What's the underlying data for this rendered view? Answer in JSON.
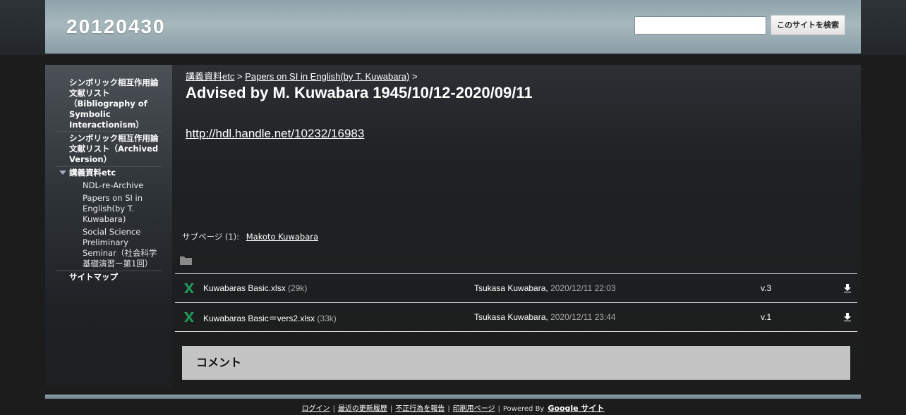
{
  "site": {
    "title": "20120430"
  },
  "search": {
    "placeholder": "",
    "button_label": "このサイトを検索"
  },
  "sidebar": {
    "items": [
      {
        "label": "シンボリック相互作用論文献リスト（Bibliography of Symbolic Interactionism）"
      },
      {
        "label": "シンボリック相互作用論文献リスト（Archived Version）"
      },
      {
        "label": "講義資料etc",
        "expanded": true,
        "children": [
          {
            "label": "NDL-re-Archive"
          },
          {
            "label": "Papers on SI in English(by T. Kuwabara)"
          },
          {
            "label": "Social Science Preliminary Seminar（社会科学基礎演習ー第1回）"
          }
        ]
      },
      {
        "label": "サイトマップ"
      }
    ]
  },
  "breadcrumb": {
    "items": [
      "講義資料etc",
      "Papers on SI in English(by T. Kuwabara)"
    ],
    "separator": ">"
  },
  "page": {
    "title": "Advised by M. Kuwabara 1945/10/12-2020/09/11",
    "link": "http://hdl.handle.net/10232/16983"
  },
  "subpages": {
    "label": "サブページ (1):",
    "items": [
      "Makoto Kuwabara"
    ]
  },
  "attachments": [
    {
      "name": "Kuwabaras Basic.xlsx",
      "size": "(29k)",
      "author": "Tsukasa Kuwabara,",
      "date": "2020/12/11 22:03",
      "version": "v.3"
    },
    {
      "name": "Kuwabaras Basic＝vers2.xlsx",
      "size": "(33k)",
      "author": "Tsukasa Kuwabara,",
      "date": "2020/12/11 23:44",
      "version": "v.1"
    }
  ],
  "comments": {
    "title": "コメント"
  },
  "footer": {
    "links": [
      "ログイン",
      "最近の更新履歴",
      "不正行為を報告",
      "印刷用ページ"
    ],
    "powered_by": "Powered By",
    "brand": "Google サイト"
  },
  "colors": {
    "header": "#a7b8bd",
    "xls_icon": "#1f9a5a",
    "comment_bg": "#c4c4c4"
  }
}
